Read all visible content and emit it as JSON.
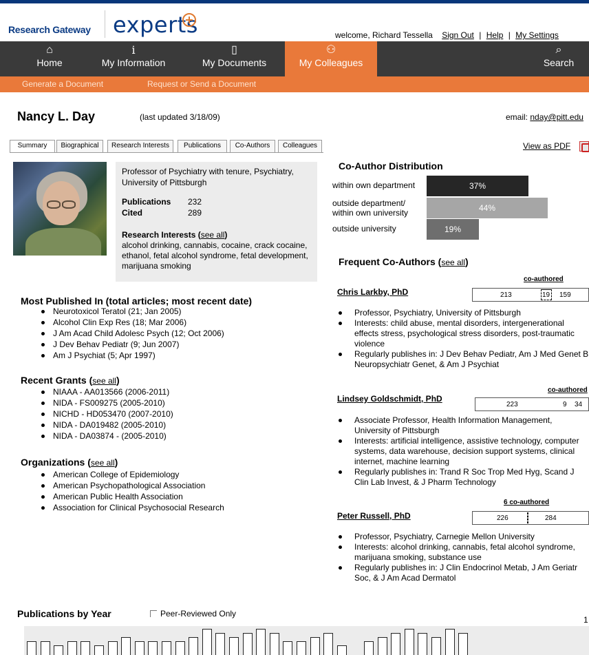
{
  "header": {
    "brand_left": "Research Gateway",
    "brand_right": "experts",
    "welcome": "welcome, Richard Tessella",
    "sign_out": "Sign Out",
    "help": "Help",
    "settings": "My Settings",
    "sep": "|"
  },
  "nav": {
    "items": [
      {
        "label": "Home",
        "icon": "home-icon",
        "glyph": "⌂"
      },
      {
        "label": "My Information",
        "icon": "info-icon",
        "glyph": "i"
      },
      {
        "label": "My Documents",
        "icon": "document-icon",
        "glyph": "▯"
      },
      {
        "label": "My Colleagues",
        "icon": "colleagues-icon",
        "glyph": "⚇"
      },
      {
        "label": "Search",
        "icon": "search-icon",
        "glyph": "⌕"
      }
    ],
    "active": "My Colleagues",
    "sub_items": [
      "Generate a Document",
      "Request or Send a Document"
    ]
  },
  "profile": {
    "name": "Nancy L. Day",
    "updated": "(last updated 3/18/09)",
    "email_label": "email:",
    "email": "nday@pitt.edu",
    "view_pdf": "View as PDF",
    "title": "Professor of Psychiatry with tenure, Psychiatry, University of Pittsburgh",
    "publications_label": "Publications",
    "publications": "232",
    "cited_label": "Cited",
    "cited": "289",
    "research_label": "Research Interests",
    "see_all": "see all",
    "research_interests": "alcohol drinking, cannabis, cocaine, crack cocaine, ethanol, fetal alcohol syndrome, fetal development, marijuana smoking"
  },
  "tabs": [
    "Summary",
    "Biographical",
    "Research Interests",
    "Publications",
    "Co-Authors",
    "Colleagues"
  ],
  "most_published": {
    "title": "Most Published In (total articles; most recent date)",
    "items": [
      "Neurotoxicol Teratol  (21; Jan 2005)",
      "Alcohol Clin Exp Res (18; Mar 2006)",
      "J Am Acad Child Adolesc Psych (12; Oct 2006)",
      "J Dev Behav Pediatr  (9; Jun 2007)",
      "Am J Psychiat (5; Apr 1997)"
    ]
  },
  "grants": {
    "title": "Recent Grants",
    "see_all": "see all",
    "items": [
      "NIAAA - AA013566 (2006-2011)",
      "NIDA - FS009275 (2005-2010)",
      "NICHD - HD053470 (2007-2010)",
      "NIDA - DA019482 (2005-2010)",
      "NIDA - DA03874 - (2005-2010)"
    ]
  },
  "organizations": {
    "title": "Organizations",
    "see_all": "see all",
    "items": [
      "American College of Epidemiology",
      "American Psychopathological Association",
      "American Public Health Association",
      "Association for Clinical Psychosocial Research"
    ]
  },
  "coauthor_distribution": {
    "title": "Co-Author Distribution",
    "rows": [
      {
        "label": "within own department",
        "value": "37%",
        "percent": 37,
        "color": "#262626"
      },
      {
        "label": "outside department/ within own university",
        "value": "44%",
        "percent": 44,
        "color": "#a6a6a6"
      },
      {
        "label": "outside university",
        "value": "19%",
        "percent": 19,
        "color": "#6e6e6e"
      }
    ]
  },
  "frequent_coauthors": {
    "title": "Frequent Co-Authors",
    "see_all": "see all",
    "people": [
      {
        "name": "Chris Larkby, PhD",
        "label": "co-authored",
        "left": "213",
        "mid": "19",
        "right": "159",
        "bullets": [
          "Professor, Psychiatry, University of Pittsburgh",
          "Interests: child abuse, mental disorders, intergenerational effects stress, psychological stress disorders, post-traumatic violence",
          "Regularly publishes in: J Dev Behav Pediatr, Am J Med Genet B Neuropsychiatr Genet, & Am J Psychiat"
        ]
      },
      {
        "name": "Lindsey Goldschmidt, PhD",
        "label": "co-authored",
        "left": "223",
        "mid": "9",
        "right": "34",
        "bullets": [
          "Associate Professor, Health Information Management, University of Pittsburgh",
          "Interests: artificial intelligence, assistive technology, computer systems, data warehouse, decision support systems, clinical internet, machine learning",
          "Regularly publishes in: Trand R Soc Trop Med Hyg, Scand J Clin Lab Invest, & J Pharm Technology"
        ]
      },
      {
        "name": "Peter Russell, PhD",
        "label": "6 co-authored",
        "left": "226",
        "mid": "",
        "right": "284",
        "bullets": [
          "Professor, Psychiatry, Carnegie Mellon University",
          "Interests: alcohol drinking, cannabis, fetal alcohol syndrome, marijuana smoking, substance use",
          "Regularly publishes in: J Clin Endocrinol Metab, J Am Geriatr Soc, & J Am Acad Dermatol"
        ]
      }
    ]
  },
  "publications_by_year": {
    "title": "Publications by Year",
    "peer_reviewed": "Peer-Reviewed Only",
    "peer_checked": false,
    "axis_top": "1",
    "bar_levels": [
      3,
      3,
      2,
      3,
      3,
      2,
      3,
      4,
      3,
      3,
      3,
      3,
      4,
      6,
      5,
      4,
      5,
      6,
      5,
      3,
      3,
      4,
      5,
      2,
      0,
      3,
      4,
      5,
      6,
      5,
      4,
      6,
      5
    ]
  }
}
